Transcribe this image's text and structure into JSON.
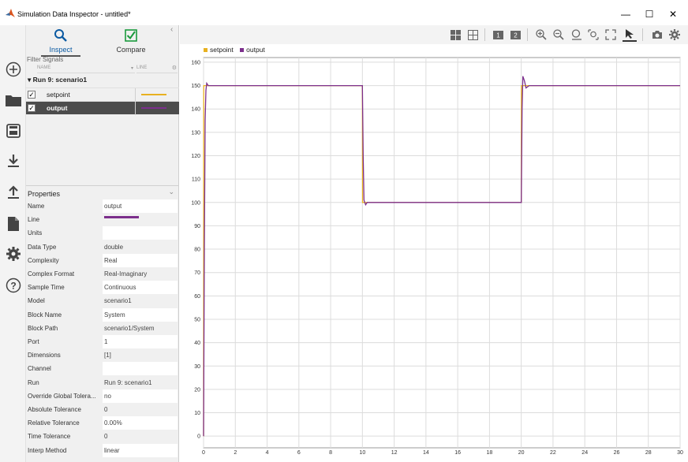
{
  "window": {
    "title": "Simulation Data Inspector - untitled*",
    "minimize_glyph": "—",
    "maximize_glyph": "☐",
    "close_glyph": "✕"
  },
  "rail": {
    "icons": [
      "new-plus-icon",
      "open-folder-icon",
      "save-disk-icon",
      "import-icon",
      "export-icon",
      "report-icon",
      "settings-gear-icon",
      "help-icon"
    ]
  },
  "tabs": {
    "inspect_label": "Inspect",
    "compare_label": "Compare",
    "collapse_glyph": "‹"
  },
  "filter": {
    "placeholder": "Filter Signals",
    "col_name": "NAME",
    "col_line": "LINE"
  },
  "signals": {
    "run_label": "▾ Run 9: scenario1",
    "rows": [
      {
        "name": "setpoint",
        "checked": "✓",
        "color": "#e8b120"
      },
      {
        "name": "output",
        "checked": "✓",
        "color": "#7c2f8c"
      }
    ]
  },
  "properties": {
    "title": "Properties",
    "chevron": "⌄",
    "rows": [
      {
        "key": "Name",
        "value": "output"
      },
      {
        "key": "Line",
        "value": ""
      },
      {
        "key": "Units",
        "value": ""
      },
      {
        "key": "Data Type",
        "value": "double"
      },
      {
        "key": "Complexity",
        "value": "Real"
      },
      {
        "key": "Complex Format",
        "value": "Real-Imaginary"
      },
      {
        "key": "Sample Time",
        "value": "Continuous"
      },
      {
        "key": "Model",
        "value": "scenario1"
      },
      {
        "key": "Block Name",
        "value": "System"
      },
      {
        "key": "Block Path",
        "value": "scenario1/System"
      },
      {
        "key": "Port",
        "value": "1"
      },
      {
        "key": "Dimensions",
        "value": "[1]"
      },
      {
        "key": "Channel",
        "value": ""
      },
      {
        "key": "Run",
        "value": "Run 9: scenario1"
      },
      {
        "key": "Override Global Tolera...",
        "value": "no"
      },
      {
        "key": "Absolute Tolerance",
        "value": "0"
      },
      {
        "key": "Relative Tolerance",
        "value": "0.00%"
      },
      {
        "key": "Time Tolerance",
        "value": "0"
      },
      {
        "key": "Interp Method",
        "value": "linear"
      }
    ]
  },
  "toolbar": {
    "icons": [
      "layout-grid-icon",
      "subplot-grid-icon",
      "single-plot-icon",
      "dual-plot-icon",
      "zoom-in-icon",
      "zoom-out-icon",
      "zoom-reset-icon",
      "zoom-box-icon",
      "fit-to-view-icon",
      "cursor-icon",
      "snapshot-camera-icon",
      "settings-icon"
    ]
  },
  "chart_data": {
    "type": "line",
    "legend_position": "top-left",
    "grid": true,
    "xlim": [
      0,
      30
    ],
    "ylim": [
      -5,
      162
    ],
    "xticks": [
      0,
      2,
      4,
      6,
      8,
      10,
      12,
      14,
      16,
      18,
      20,
      22,
      24,
      26,
      28,
      30
    ],
    "yticks": [
      0,
      10,
      20,
      30,
      40,
      50,
      60,
      70,
      80,
      90,
      100,
      110,
      120,
      130,
      140,
      150,
      160
    ],
    "series": [
      {
        "name": "setpoint",
        "color": "#e8b120",
        "x": [
          0,
          0.01,
          10,
          10.01,
          20,
          20.01,
          30
        ],
        "y": [
          0,
          150,
          150,
          100,
          100,
          150,
          150
        ]
      },
      {
        "name": "output",
        "color": "#7c2f8c",
        "x": [
          0,
          0.05,
          0.1,
          0.15,
          0.2,
          0.3,
          10,
          10.05,
          10.1,
          10.2,
          10.3,
          20,
          20.05,
          20.1,
          20.2,
          20.3,
          20.5,
          30
        ],
        "y": [
          0,
          80,
          135,
          148,
          151,
          150,
          150,
          120,
          101,
          99,
          100,
          100,
          140,
          154,
          152,
          149,
          150,
          150
        ]
      }
    ]
  }
}
